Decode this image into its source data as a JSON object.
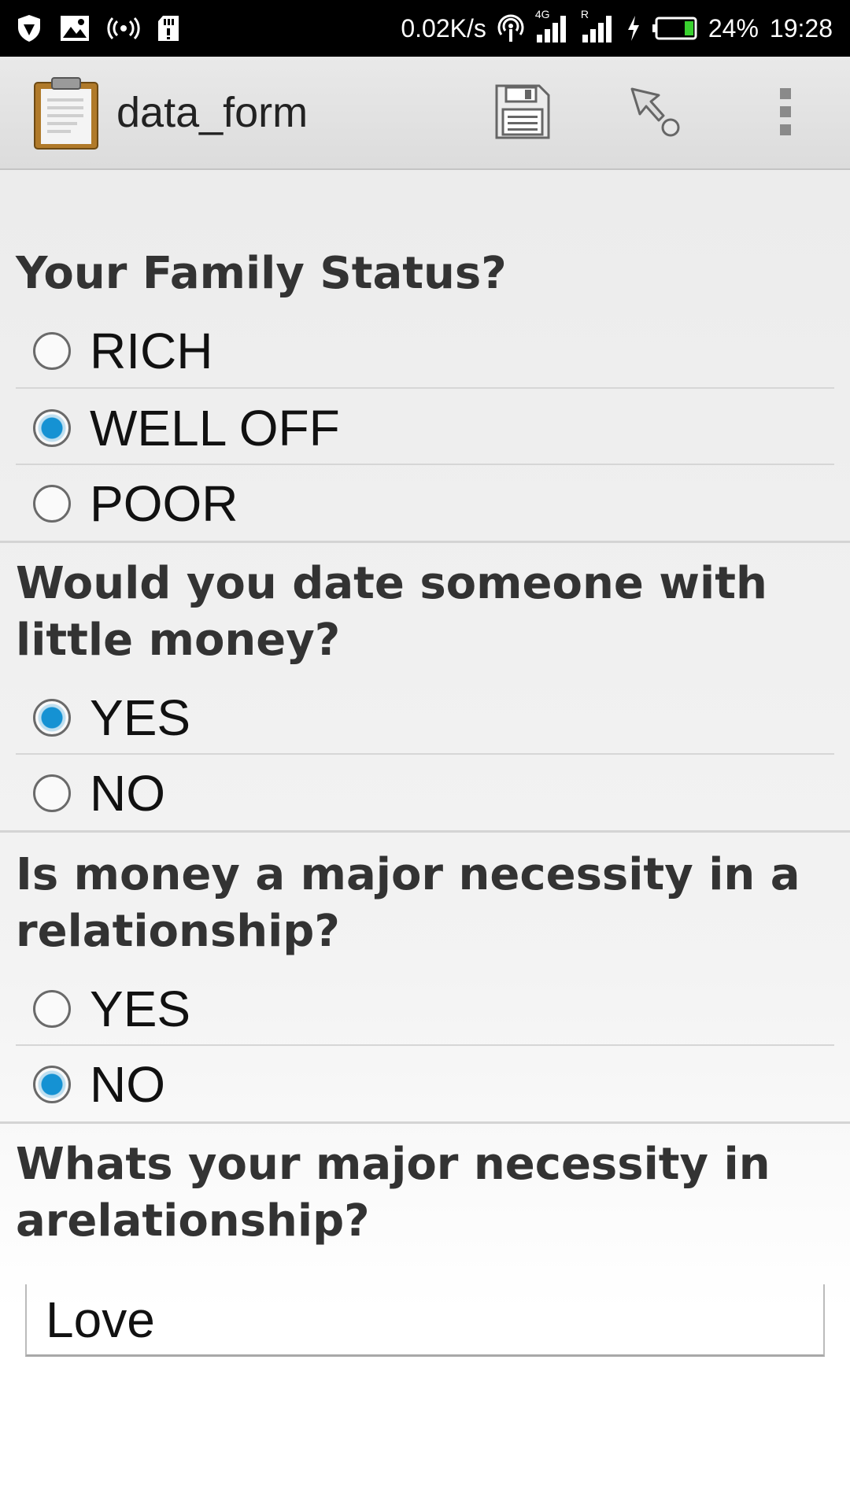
{
  "status_bar": {
    "network_speed": "0.02K/s",
    "network_type": "4G",
    "roaming": "R",
    "battery": "24%",
    "time": "19:28",
    "icons": [
      "shield-icon",
      "image-icon",
      "broadcast-icon",
      "sd-card-icon",
      "hotspot-icon",
      "signal-icon",
      "signal-roaming-icon",
      "charging-icon",
      "battery-icon"
    ]
  },
  "app_bar": {
    "title": "data_form",
    "icons": [
      "clipboard-icon",
      "save-icon",
      "pointer-icon",
      "overflow-menu-icon"
    ]
  },
  "form": {
    "q1": {
      "question": "Your Family Status?",
      "options": [
        "RICH",
        "WELL OFF",
        "POOR"
      ],
      "selected": "WELL OFF"
    },
    "q2": {
      "question": "Would you date someone with little money?",
      "options": [
        "YES",
        "NO"
      ],
      "selected": "YES"
    },
    "q3": {
      "question": "Is money a major necessity in a relationship?",
      "options": [
        "YES",
        "NO"
      ],
      "selected": "NO"
    },
    "q4": {
      "question": "Whats your major necessity in arelationship?",
      "answer": "Love"
    }
  },
  "colors": {
    "accent": "#1592d3",
    "appbar": "#e2e2e2",
    "statusbar": "#000000"
  }
}
